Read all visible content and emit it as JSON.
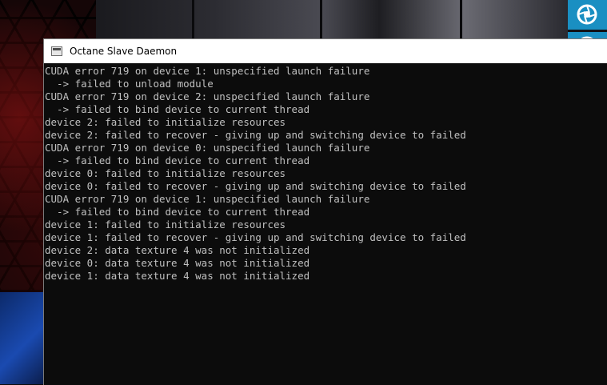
{
  "window": {
    "title": "Octane Slave Daemon"
  },
  "console": {
    "lines": [
      "CUDA error 719 on device 1: unspecified launch failure",
      "  -> failed to unload module",
      "CUDA error 719 on device 2: unspecified launch failure",
      "  -> failed to bind device to current thread",
      "device 2: failed to initialize resources",
      "device 2: failed to recover - giving up and switching device to failed",
      "CUDA error 719 on device 0: unspecified launch failure",
      "  -> failed to bind device to current thread",
      "device 0: failed to initialize resources",
      "device 0: failed to recover - giving up and switching device to failed",
      "CUDA error 719 on device 1: unspecified launch failure",
      "  -> failed to bind device to current thread",
      "device 1: failed to initialize resources",
      "device 1: failed to recover - giving up and switching device to failed",
      "device 2: data texture 4 was not initialized",
      "device 0: data texture 4 was not initialized",
      "device 1: data texture 4 was not initialized"
    ]
  },
  "colors": {
    "console_bg": "#0c0c0c",
    "console_text": "#c0c0c0",
    "titlebar_bg": "#ffffff",
    "tile_blue": "#1a8fc2"
  },
  "icons": {
    "window_icon": "console-window-icon",
    "tile_top": "aperture-icon",
    "tile_bottom": "aperture-icon"
  }
}
